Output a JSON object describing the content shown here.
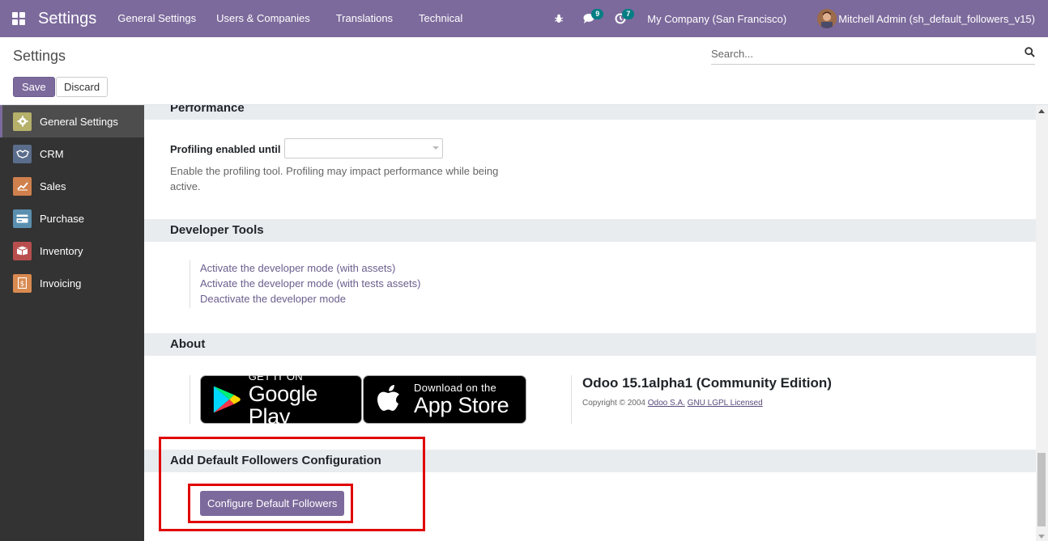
{
  "navbar": {
    "brand": "Settings",
    "menus": [
      "General Settings",
      "Users & Companies",
      "Translations",
      "Technical"
    ],
    "messages_count": "9",
    "activities_count": "7",
    "company": "My Company (San Francisco)",
    "user": "Mitchell Admin (sh_default_followers_v15)"
  },
  "control_panel": {
    "title": "Settings",
    "search_placeholder": "Search...",
    "save_label": "Save",
    "discard_label": "Discard"
  },
  "sidebar": {
    "items": [
      {
        "label": "General Settings",
        "icon": "gear-icon",
        "color": "#b5b06a"
      },
      {
        "label": "CRM",
        "icon": "handshake-icon",
        "color": "#5b6d8c"
      },
      {
        "label": "Sales",
        "icon": "chart-line-icon",
        "color": "#d0804d"
      },
      {
        "label": "Purchase",
        "icon": "credit-card-icon",
        "color": "#5a8fb0"
      },
      {
        "label": "Inventory",
        "icon": "box-icon",
        "color": "#b84e4e"
      },
      {
        "label": "Invoicing",
        "icon": "invoice-icon",
        "color": "#d98a50"
      }
    ]
  },
  "performance": {
    "header": "Performance",
    "field_label": "Profiling enabled until",
    "help_line1": "Enable the profiling tool. Profiling may impact performance while being",
    "help_line2": "active."
  },
  "developer_tools": {
    "header": "Developer Tools",
    "links": [
      "Activate the developer mode (with assets)",
      "Activate the developer mode (with tests assets)",
      "Deactivate the developer mode"
    ]
  },
  "about": {
    "header": "About",
    "google_play_small": "GET IT ON",
    "google_play_big": "Google Play",
    "app_store_small": "Download on the",
    "app_store_big": "App Store",
    "version": "Odoo 15.1alpha1 (Community Edition)",
    "copyright": "Copyright © 2004",
    "company_link": "Odoo S.A.",
    "license_link": "GNU LGPL Licensed"
  },
  "followers": {
    "header": "Add Default Followers Configuration",
    "button_label": "Configure Default Followers"
  },
  "colors": {
    "brand": "#7c6a9c",
    "highlight": "#e00000",
    "badge": "#017e84"
  }
}
